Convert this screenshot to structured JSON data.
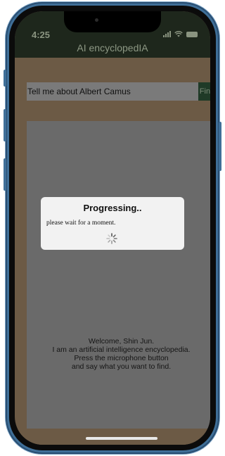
{
  "status_bar": {
    "time": "4:25",
    "icons": [
      "signal-icon",
      "wifi-icon",
      "battery-icon"
    ]
  },
  "app": {
    "title": "AI encyclopedIA"
  },
  "search": {
    "value": "Tell me about Albert Camus",
    "find_label": "Find"
  },
  "welcome": {
    "lines": [
      "Welcome, Shin Jun.",
      "I am an artificial intelligence encyclopedia.",
      "Press the microphone button",
      "and say what you want to find."
    ]
  },
  "dialog": {
    "title": "Progressing..",
    "message": "please wait for a moment.",
    "icon": "spinner-icon"
  },
  "colors": {
    "device_frame": "#3f6f98",
    "header_bg": "#1e271c",
    "app_bg": "#6c5a45",
    "panel_bg": "#6a6a6a",
    "find_button_bg": "#1f3a27",
    "dialog_bg": "#f2f2f2"
  }
}
